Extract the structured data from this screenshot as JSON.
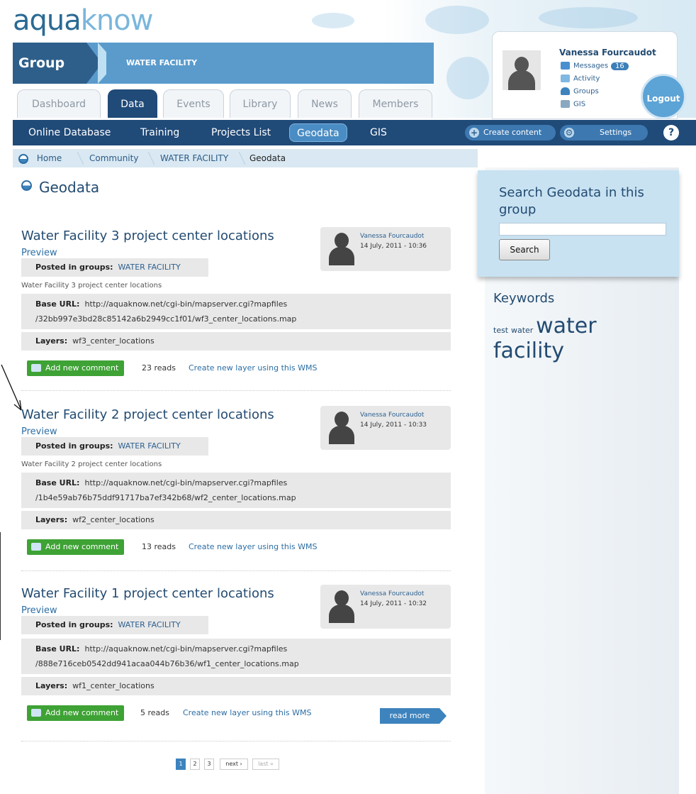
{
  "header": {
    "logo_part1": "aqua",
    "logo_part2": "know",
    "group_label": "Group",
    "group_name": "WATER FACILITY",
    "tabs": [
      {
        "label": "Dashboard",
        "active": false
      },
      {
        "label": "Data",
        "active": true
      },
      {
        "label": "Events",
        "active": false
      },
      {
        "label": "Library",
        "active": false
      },
      {
        "label": "News",
        "active": false
      },
      {
        "label": "Members",
        "active": false
      }
    ]
  },
  "user": {
    "name": "Vanessa Fourcaudot",
    "messages_label": "Messages",
    "messages_count": "16",
    "activity_label": "Activity",
    "groups_label": "Groups",
    "gis_label": "GIS",
    "logout_label": "Logout"
  },
  "nav": {
    "items": [
      "Online Database",
      "Training",
      "Projects List",
      "Geodata",
      "GIS"
    ],
    "active": "Geodata",
    "create_content": "Create content",
    "settings": "Settings",
    "help": "?"
  },
  "breadcrumb": [
    "Home",
    "Community",
    "WATER FACILITY",
    "Geodata"
  ],
  "page": {
    "title": "Geodata"
  },
  "posts": [
    {
      "title": "Water Facility 3 project center locations",
      "preview": "Preview",
      "author": "Vanessa Fourcaudot",
      "date": "14 July, 2011 - 10:36",
      "groups_label": "Posted in groups:",
      "groups_value": "WATER FACILITY",
      "description": "Water Facility 3 project center locations",
      "base_url_label": "Base URL:",
      "base_url_line1": "http://aquaknow.net/cgi-bin/mapserver.cgi?mapfiles",
      "base_url_line2": "/32bb997e3bd28c85142a6b2949cc1f01/wf3_center_locations.map",
      "layers_label": "Layers:",
      "layers_value": "wf3_center_locations",
      "comment_label": "Add new comment",
      "reads": "23 reads",
      "wms_link": "Create new layer using this WMS"
    },
    {
      "title": "Water Facility 2 project center locations",
      "preview": "Preview",
      "author": "Vanessa Fourcaudot",
      "date": "14 July, 2011 - 10:33",
      "groups_label": "Posted in groups:",
      "groups_value": "WATER FACILITY",
      "description": "Water Facility 2 project center locations",
      "base_url_label": "Base URL:",
      "base_url_line1": "http://aquaknow.net/cgi-bin/mapserver.cgi?mapfiles",
      "base_url_line2": "/1b4e59ab76b75ddf91717ba7ef342b68/wf2_center_locations.map",
      "layers_label": "Layers:",
      "layers_value": "wf2_center_locations",
      "comment_label": "Add new comment",
      "reads": "13 reads",
      "wms_link": "Create new layer using this WMS"
    },
    {
      "title": "Water Facility 1 project center locations",
      "preview": "Preview",
      "author": "Vanessa Fourcaudot",
      "date": "14 July, 2011 - 10:32",
      "groups_label": "Posted in groups:",
      "groups_value": "WATER FACILITY",
      "description": "",
      "base_url_label": "Base URL:",
      "base_url_line1": "http://aquaknow.net/cgi-bin/mapserver.cgi?mapfiles",
      "base_url_line2": "/888e716ceb0542dd941acaa044b76b36/wf1_center_locations.map",
      "layers_label": "Layers:",
      "layers_value": "wf1_center_locations",
      "comment_label": "Add new comment",
      "reads": "5 reads",
      "wms_link": "Create new layer using this WMS",
      "read_more": "read more"
    }
  ],
  "pager": {
    "pages": [
      "1",
      "2",
      "3"
    ],
    "current": "1",
    "next": "next ›",
    "last": "last »"
  },
  "sidebar": {
    "search_heading": "Search Geodata in this group",
    "search_value": "",
    "search_button": "Search",
    "keywords_heading": "Keywords",
    "keywords": [
      {
        "text": "test",
        "size": "small"
      },
      {
        "text": "water",
        "size": "small"
      },
      {
        "text": "water facility",
        "size": "large"
      }
    ]
  },
  "colors": {
    "nav_bg": "#204a78",
    "accent": "#3d83bd",
    "comment_green": "#3ea235",
    "title_blue": "#234b71"
  }
}
